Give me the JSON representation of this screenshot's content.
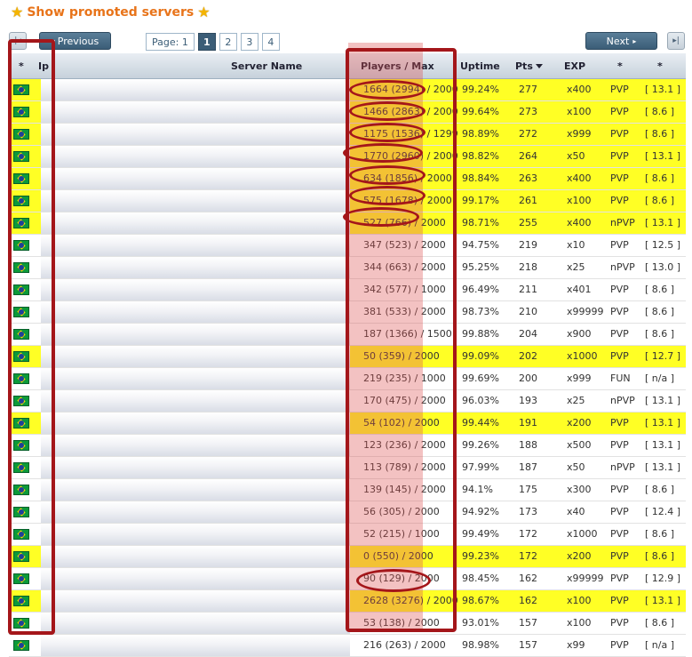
{
  "header": {
    "promoted_link": "Show promoted servers",
    "previous_label": "Previous",
    "next_label": "Next",
    "page_label": "Page: 1",
    "pages": [
      "1",
      "2",
      "3",
      "4"
    ],
    "active_page": "1"
  },
  "table": {
    "columns": {
      "star": "*",
      "ip": "Ip",
      "server_name": "Server Name",
      "players": "Players / Max",
      "uptime": "Uptime",
      "pts": "Pts",
      "exp": "EXP",
      "type": "*",
      "version": "*"
    },
    "rows": [
      {
        "players": "1664 (2994) / 2000",
        "uptime": "99.24%",
        "pts": "277",
        "exp": "x400",
        "type": "PVP",
        "version": "[ 13.1 ]",
        "promo": true
      },
      {
        "players": "1466 (2863) / 2000",
        "uptime": "99.64%",
        "pts": "273",
        "exp": "x100",
        "type": "PVP",
        "version": "[ 8.6 ]",
        "promo": true
      },
      {
        "players": "1175 (1536) / 1299",
        "uptime": "98.89%",
        "pts": "272",
        "exp": "x999",
        "type": "PVP",
        "version": "[ 8.6 ]",
        "promo": true
      },
      {
        "players": "1770 (2960) / 2000",
        "uptime": "98.82%",
        "pts": "264",
        "exp": "x50",
        "type": "PVP",
        "version": "[ 13.1 ]",
        "promo": true
      },
      {
        "players": "634 (1856) / 2000",
        "uptime": "98.84%",
        "pts": "263",
        "exp": "x400",
        "type": "PVP",
        "version": "[ 8.6 ]",
        "promo": true
      },
      {
        "players": "575 (1678) / 2000",
        "uptime": "99.17%",
        "pts": "261",
        "exp": "x100",
        "type": "PVP",
        "version": "[ 8.6 ]",
        "promo": true
      },
      {
        "players": "527 (766) / 2000",
        "uptime": "98.71%",
        "pts": "255",
        "exp": "x400",
        "type": "nPVP",
        "version": "[ 13.1 ]",
        "promo": true
      },
      {
        "players": "347 (523) / 2000",
        "uptime": "94.75%",
        "pts": "219",
        "exp": "x10",
        "type": "PVP",
        "version": "[ 12.5 ]",
        "promo": false
      },
      {
        "players": "344 (663) / 2000",
        "uptime": "95.25%",
        "pts": "218",
        "exp": "x25",
        "type": "nPVP",
        "version": "[ 13.0 ]",
        "promo": false
      },
      {
        "players": "342 (577) / 1000",
        "uptime": "96.49%",
        "pts": "211",
        "exp": "x401",
        "type": "PVP",
        "version": "[ 8.6 ]",
        "promo": false
      },
      {
        "players": "381 (533) / 2000",
        "uptime": "98.73%",
        "pts": "210",
        "exp": "x99999",
        "type": "PVP",
        "version": "[ 8.6 ]",
        "promo": false
      },
      {
        "players": "187 (1366) / 1500",
        "uptime": "99.88%",
        "pts": "204",
        "exp": "x900",
        "type": "PVP",
        "version": "[ 8.6 ]",
        "promo": false
      },
      {
        "players": "50 (359) / 2000",
        "uptime": "99.09%",
        "pts": "202",
        "exp": "x1000",
        "type": "PVP",
        "version": "[ 12.7 ]",
        "promo": true
      },
      {
        "players": "219 (235) / 1000",
        "uptime": "99.69%",
        "pts": "200",
        "exp": "x999",
        "type": "FUN",
        "version": "[ n/a ]",
        "promo": false
      },
      {
        "players": "170 (475) / 2000",
        "uptime": "96.03%",
        "pts": "193",
        "exp": "x25",
        "type": "nPVP",
        "version": "[ 13.1 ]",
        "promo": false
      },
      {
        "players": "54 (102) / 2000",
        "uptime": "99.44%",
        "pts": "191",
        "exp": "x200",
        "type": "PVP",
        "version": "[ 13.1 ]",
        "promo": true
      },
      {
        "players": "123 (236) / 2000",
        "uptime": "99.26%",
        "pts": "188",
        "exp": "x500",
        "type": "PVP",
        "version": "[ 13.1 ]",
        "promo": false
      },
      {
        "players": "113 (789) / 2000",
        "uptime": "97.99%",
        "pts": "187",
        "exp": "x50",
        "type": "nPVP",
        "version": "[ 13.1 ]",
        "promo": false
      },
      {
        "players": "139 (145) / 2000",
        "uptime": "94.1%",
        "pts": "175",
        "exp": "x300",
        "type": "PVP",
        "version": "[ 8.6 ]",
        "promo": false
      },
      {
        "players": "56 (305) / 2000",
        "uptime": "94.92%",
        "pts": "173",
        "exp": "x40",
        "type": "PVP",
        "version": "[ 12.4 ]",
        "promo": false
      },
      {
        "players": "52 (215) / 1000",
        "uptime": "99.49%",
        "pts": "172",
        "exp": "x1000",
        "type": "PVP",
        "version": "[ 8.6 ]",
        "promo": false
      },
      {
        "players": "0 (550) / 2000",
        "uptime": "99.23%",
        "pts": "172",
        "exp": "x200",
        "type": "PVP",
        "version": "[ 8.6 ]",
        "promo": true
      },
      {
        "players": "90 (129) / 2000",
        "uptime": "98.45%",
        "pts": "162",
        "exp": "x99999",
        "type": "PVP",
        "version": "[ 12.9 ]",
        "promo": false
      },
      {
        "players": "2628 (3276) / 2000",
        "uptime": "98.67%",
        "pts": "162",
        "exp": "x100",
        "type": "PVP",
        "version": "[ 13.1 ]",
        "promo": true
      },
      {
        "players": "53 (138) / 2000",
        "uptime": "93.01%",
        "pts": "157",
        "exp": "x100",
        "type": "PVP",
        "version": "[ 8.6 ]",
        "promo": false
      },
      {
        "players": "216 (263) / 2000",
        "uptime": "98.98%",
        "pts": "157",
        "exp": "x99",
        "type": "PVP",
        "version": "[ n/a ]",
        "promo": false
      }
    ]
  },
  "colors": {
    "promo_row": "#ffff25",
    "annotation": "#a4161a",
    "link": "#e8741a",
    "button": "#3b5d77"
  }
}
